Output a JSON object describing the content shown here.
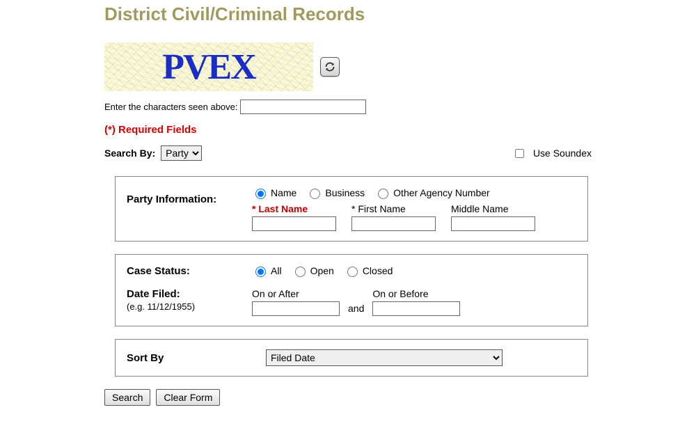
{
  "page": {
    "title": "District Civil/Criminal Records"
  },
  "captcha": {
    "text": "PVEX",
    "input_label": "Enter the characters seen above:",
    "value": ""
  },
  "required_note": "(*) Required Fields",
  "searchby": {
    "label": "Search By:",
    "selected": "Party",
    "soundex_label": "Use Soundex",
    "soundex_checked": false
  },
  "party": {
    "section_label": "Party Information:",
    "radios": {
      "name": "Name",
      "business": "Business",
      "other": "Other Agency Number"
    },
    "selected_radio": "name",
    "fields": {
      "last_name": {
        "label": "Last Name",
        "required_star": "* ",
        "value": ""
      },
      "first_name": {
        "label": "First Name",
        "required_star": "* ",
        "value": ""
      },
      "middle_name": {
        "label": "Middle Name",
        "value": ""
      }
    }
  },
  "case_status": {
    "label": "Case Status:",
    "options": {
      "all": "All",
      "open": "Open",
      "closed": "Closed"
    },
    "selected": "all"
  },
  "date_filed": {
    "label": "Date Filed:",
    "hint": "(e.g. 11/12/1955)",
    "on_after_label": "On or After",
    "on_before_label": "On or Before",
    "and_text": "and",
    "on_after_value": "",
    "on_before_value": ""
  },
  "sort": {
    "label": "Sort By",
    "selected": "Filed Date"
  },
  "buttons": {
    "search": "Search",
    "clear": "Clear Form"
  }
}
